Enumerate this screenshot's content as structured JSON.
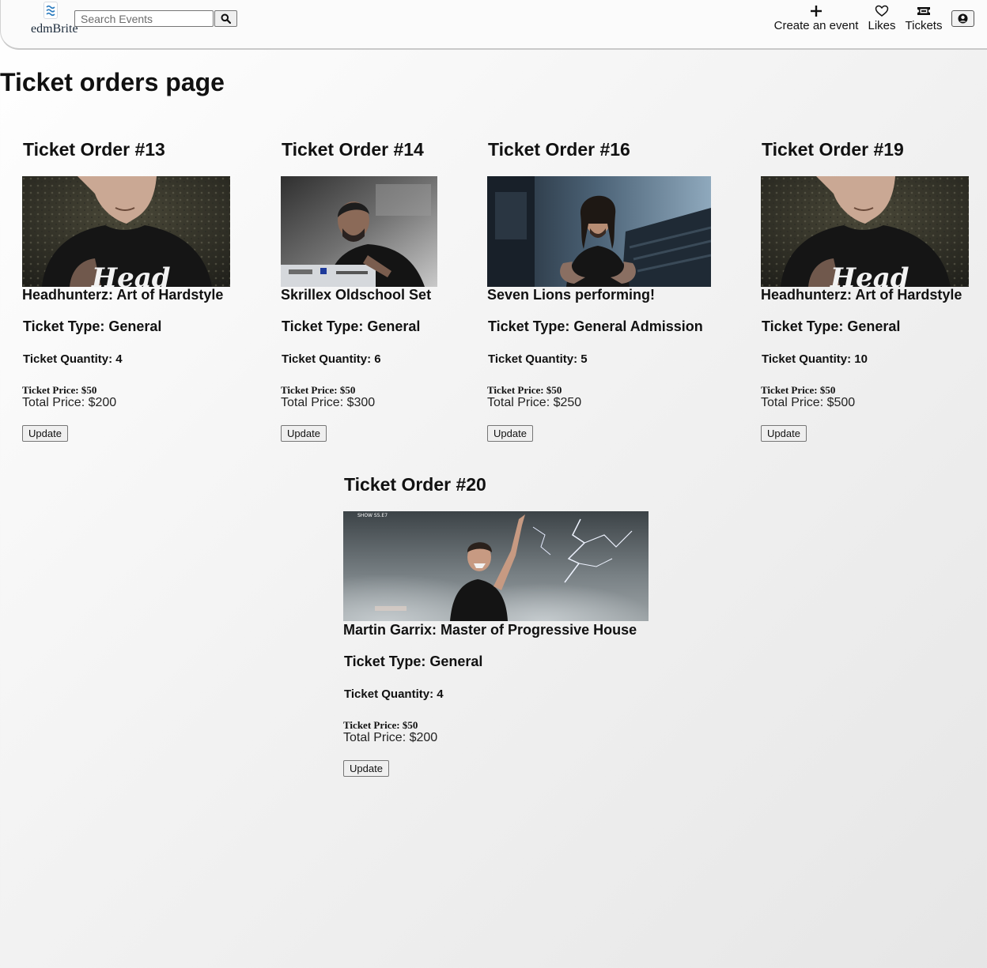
{
  "header": {
    "logo_text": "edmBrite",
    "search": {
      "placeholder": "Search Events",
      "value": ""
    },
    "nav": {
      "create_label": "Create an event",
      "likes_label": "Likes",
      "tickets_label": "Tickets"
    }
  },
  "page": {
    "title": "Ticket orders page"
  },
  "orders": [
    {
      "title": "Ticket Order #13",
      "event_name": "Headhunterz: Art of Hardstyle",
      "ticket_type": "Ticket Type: General",
      "ticket_quantity": "Ticket Quantity: 4",
      "ticket_price": "Ticket Price: $50",
      "total_price": "Total Price: $200",
      "update_label": "Update",
      "image_overlay_text": "Head"
    },
    {
      "title": "Ticket Order #14",
      "event_name": "Skrillex Oldschool Set",
      "ticket_type": "Ticket Type: General",
      "ticket_quantity": "Ticket Quantity: 6",
      "ticket_price": "Ticket Price: $50",
      "total_price": "Total Price: $300",
      "update_label": "Update"
    },
    {
      "title": "Ticket Order #16",
      "event_name": "Seven Lions performing!",
      "ticket_type": "Ticket Type: General Admission",
      "ticket_quantity": "Ticket Quantity: 5",
      "ticket_price": "Ticket Price: $50",
      "total_price": "Total Price: $250",
      "update_label": "Update"
    },
    {
      "title": "Ticket Order #19",
      "event_name": "Headhunterz: Art of Hardstyle",
      "ticket_type": "Ticket Type: General",
      "ticket_quantity": "Ticket Quantity: 10",
      "ticket_price": "Ticket Price: $50",
      "total_price": "Total Price: $500",
      "update_label": "Update",
      "image_overlay_text": "Head"
    },
    {
      "title": "Ticket Order #20",
      "event_name": "Martin Garrix: Master of Progressive House",
      "ticket_type": "Ticket Type: General",
      "ticket_quantity": "Ticket Quantity: 4",
      "ticket_price": "Ticket Price: $50",
      "total_price": "Total Price: $200",
      "update_label": "Update",
      "image_overlay_text": "SHOW S5.E7"
    }
  ],
  "colors": {
    "text": "#111111",
    "button_bg": "#efefef",
    "button_border": "#767676",
    "logo_accent": "#2b7bbf"
  },
  "icons": {
    "search": "magnifier-icon",
    "create": "plus-icon",
    "likes": "heart-icon",
    "tickets": "ticket-icon",
    "profile": "user-circle-icon"
  }
}
